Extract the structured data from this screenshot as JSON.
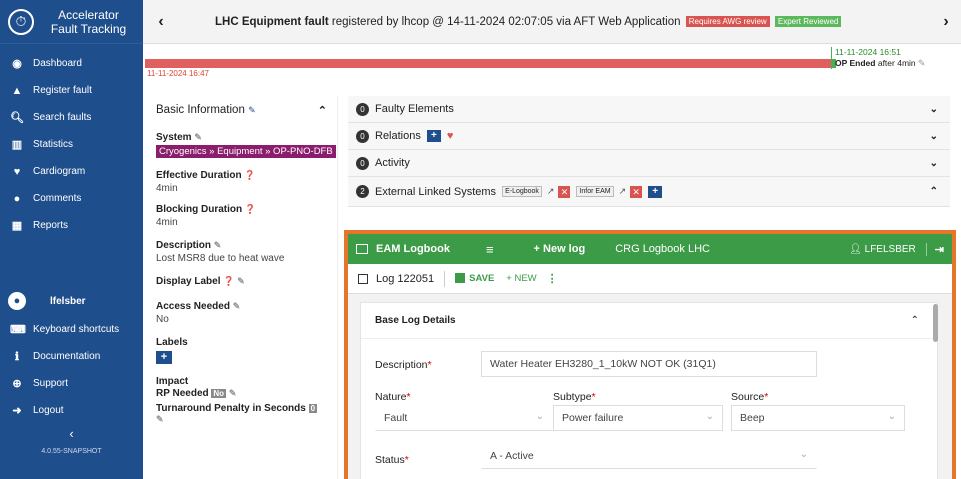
{
  "app": {
    "brand_line1": "Accelerator",
    "brand_line2": "Fault Tracking",
    "version": "4.0.55-SNAPSHOT"
  },
  "sidebar": {
    "items": [
      {
        "label": "Dashboard",
        "icon": "dashboard-icon"
      },
      {
        "label": "Register fault",
        "icon": "warning-icon"
      },
      {
        "label": "Search faults",
        "icon": "search-icon"
      },
      {
        "label": "Statistics",
        "icon": "bar-chart-icon"
      },
      {
        "label": "Cardiogram",
        "icon": "heartbeat-icon"
      },
      {
        "label": "Comments",
        "icon": "comments-icon"
      },
      {
        "label": "Reports",
        "icon": "table-icon"
      }
    ],
    "user": "lfelsber",
    "bottom_items": [
      {
        "label": "Keyboard shortcuts",
        "icon": "keyboard-icon"
      },
      {
        "label": "Documentation",
        "icon": "info-icon"
      },
      {
        "label": "Support",
        "icon": "lifebuoy-icon"
      },
      {
        "label": "Logout",
        "icon": "logout-icon"
      }
    ]
  },
  "header": {
    "title_bold": "LHC Equipment fault",
    "title_rest": "registered by lhcop @ 14-11-2024 02:07:05 via AFT Web Application",
    "badge_review": "Requires AWG review",
    "badge_expert": "Expert Reviewed"
  },
  "timeline": {
    "start": "11-11-2024 16:47",
    "end": "11-11-2024 16:51",
    "op_ended": "OP Ended",
    "after": "after 4min"
  },
  "basic_info": {
    "title": "Basic Information",
    "system_label": "System",
    "system_value": "Cryogenics » Equipment » OP-PNO-DFB",
    "effective_label": "Effective Duration",
    "effective_value": "4min",
    "blocking_label": "Blocking Duration",
    "blocking_value": "4min",
    "description_label": "Description",
    "description_value": "Lost MSR8 due to heat wave",
    "display_label": "Display Label",
    "access_label": "Access Needed",
    "access_value": "No",
    "labels_label": "Labels",
    "impact_label": "Impact",
    "rp_label": "RP Needed",
    "rp_value": "No",
    "turnaround_label": "Turnaround Penalty in Seconds",
    "turnaround_value": "0"
  },
  "panels": {
    "faulty_count": "0",
    "faulty_label": "Faulty Elements",
    "relations_count": "0",
    "relations_label": "Relations",
    "activity_count": "0",
    "activity_label": "Activity",
    "external_count": "2",
    "external_label": "External Linked Systems",
    "ext1": "E-Logbook",
    "ext2": "Infor EAM"
  },
  "eam": {
    "app_name": "EAM Logbook",
    "new_log": "+ New log",
    "crg": "CRG Logbook LHC",
    "user": "LFELSBER",
    "log_number": "Log 122051",
    "save": "SAVE",
    "new": "+ NEW",
    "section": "Base Log Details",
    "description_label": "Description",
    "description_value": "Water Heater EH3280_1_10kW NOT OK (31Q1)",
    "nature_label": "Nature",
    "nature_value": "Fault",
    "subtype_label": "Subtype",
    "subtype_value": "Power failure",
    "source_label": "Source",
    "source_value": "Beep",
    "status_label": "Status",
    "status_value": "A - Active"
  },
  "colors": {
    "sidebar": "#1f4e8c",
    "eam_green": "#3c9b46",
    "highlight_orange": "#e5752a",
    "timeline_red": "#e06060"
  }
}
